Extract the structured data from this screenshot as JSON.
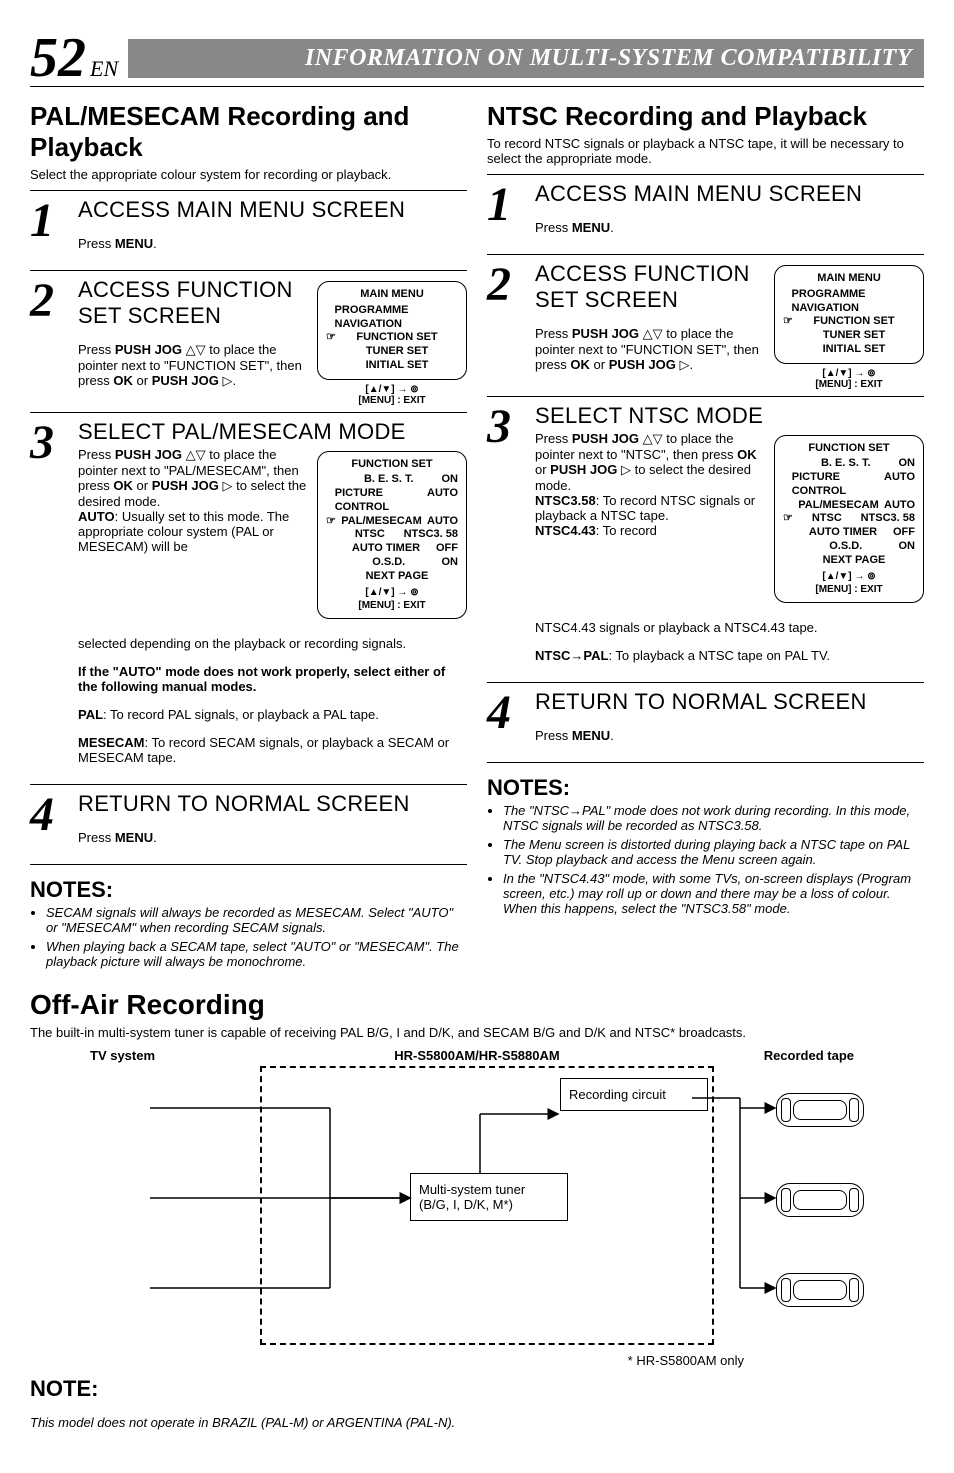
{
  "header": {
    "pagenum": "52",
    "lang": "EN",
    "banner": "INFORMATION ON MULTI-SYSTEM COMPATIBILITY"
  },
  "left": {
    "title": "PAL/MESECAM Recording and Playback",
    "lead": "Select the appropriate colour system for recording or playback.",
    "steps": {
      "s1": {
        "num": "1",
        "title": "ACCESS MAIN MENU SCREEN",
        "text_a": "Press ",
        "b1": "MENU",
        "text_b": "."
      },
      "s2": {
        "num": "2",
        "title": "ACCESS FUNCTION SET SCREEN",
        "run1a": "Press ",
        "run1b": "PUSH JOG",
        "run1c": " △▽ to place the pointer next to \"FUNCTION SET\", then press ",
        "run1d": "OK",
        "run1e": " or ",
        "run1f": "PUSH JOG",
        "run1g": " ▷."
      },
      "s3": {
        "num": "3",
        "title": "SELECT PAL/MESECAM MODE",
        "run_a": "Press ",
        "run_b": "PUSH JOG",
        "run_c": " △▽ to place the pointer next to \"PAL/MESECAM\", then press ",
        "run_d": "OK",
        "run_e": " or ",
        "run_f": "PUSH JOG",
        "run_g": " ▷ to select the desired mode.",
        "auto_l": "AUTO",
        "auto_t": ": Usually set to this mode. The appropriate colour system (PAL or MESECAM) will be",
        "tail": "selected depending on the playback or recording signals.",
        "warn": "If the \"AUTO\" mode does not work properly, select either of the following manual modes.",
        "pal_l": "PAL",
        "pal_t": ": To record PAL signals, or playback a PAL tape.",
        "mes_l": "MESECAM",
        "mes_t": ": To record SECAM signals, or playback a SECAM or MESECAM tape."
      },
      "s4": {
        "num": "4",
        "title": "RETURN TO NORMAL SCREEN",
        "text_a": "Press ",
        "b1": "MENU",
        "text_b": "."
      }
    },
    "osd_main": {
      "title": "MAIN MENU",
      "items": [
        "PROGRAMME NAVIGATION",
        "FUNCTION SET",
        "TUNER SET",
        "INITIAL SET"
      ],
      "pointer_idx": 1,
      "foot1": "[▲/▼] → ⊚",
      "foot2": "[MENU] : EXIT"
    },
    "osd_func": {
      "title": "FUNCTION SET",
      "rows": [
        {
          "l": "B. E. S. T.",
          "r": "ON"
        },
        {
          "l": "PICTURE CONTROL",
          "r": "AUTO"
        },
        {
          "l": "PAL/MESECAM",
          "r": "AUTO"
        },
        {
          "l": "NTSC",
          "r": "NTSC3. 58"
        },
        {
          "l": "AUTO TIMER",
          "r": "OFF"
        },
        {
          "l": "O.S.D.",
          "r": "ON"
        },
        {
          "l": "NEXT PAGE",
          "r": ""
        }
      ],
      "pointer_idx": 2,
      "foot1": "[▲/▼] → ⊚",
      "foot2": "[MENU] : EXIT"
    },
    "notes_h": "NOTES:",
    "notes": [
      "SECAM signals will always be recorded as MESECAM. Select \"AUTO\" or \"MESECAM\" when recording SECAM signals.",
      "When playing back a SECAM tape, select \"AUTO\" or \"MESECAM\". The playback picture will always be monochrome."
    ]
  },
  "right": {
    "title": "NTSC Recording and Playback",
    "lead": "To record NTSC signals or playback a NTSC tape, it will be necessary to select the appropriate mode.",
    "steps": {
      "s1": {
        "num": "1",
        "title": "ACCESS MAIN MENU SCREEN",
        "text_a": "Press ",
        "b1": "MENU",
        "text_b": "."
      },
      "s2": {
        "num": "2",
        "title": "ACCESS FUNCTION SET SCREEN",
        "run1a": "Press ",
        "run1b": "PUSH JOG",
        "run1c": " △▽ to place the pointer next to \"FUNCTION SET\", then press ",
        "run1d": "OK",
        "run1e": " or ",
        "run1f": "PUSH JOG",
        "run1g": " ▷."
      },
      "s3": {
        "num": "3",
        "title": "SELECT NTSC MODE",
        "run_a": "Press ",
        "run_b": "PUSH JOG",
        "run_c": " △▽ to place the pointer next to \"NTSC\", then press ",
        "run_d": "OK",
        "run_e": " or ",
        "run_f": "PUSH JOG",
        "run_g": " ▷ to select the desired mode.",
        "n358_l": "NTSC3.58",
        "n358_t": ": To record NTSC signals or playback a NTSC tape.",
        "n443_l": "NTSC4.43",
        "n443_t": ": To record",
        "n443_t2": "NTSC4.43 signals or playback a NTSC4.43 tape.",
        "np_l": "NTSC→PAL",
        "np_t": ": To playback a NTSC tape on PAL TV."
      },
      "s4": {
        "num": "4",
        "title": "RETURN TO NORMAL SCREEN",
        "text_a": "Press ",
        "b1": "MENU",
        "text_b": "."
      }
    },
    "osd_main": {
      "title": "MAIN MENU",
      "items": [
        "PROGRAMME NAVIGATION",
        "FUNCTION SET",
        "TUNER SET",
        "INITIAL SET"
      ],
      "pointer_idx": 1,
      "foot1": "[▲/▼] → ⊚",
      "foot2": "[MENU] : EXIT"
    },
    "osd_func": {
      "title": "FUNCTION SET",
      "rows": [
        {
          "l": "B. E. S. T.",
          "r": "ON"
        },
        {
          "l": "PICTURE CONTROL",
          "r": "AUTO"
        },
        {
          "l": "PAL/MESECAM",
          "r": "AUTO"
        },
        {
          "l": "NTSC",
          "r": "NTSC3. 58"
        },
        {
          "l": "AUTO TIMER",
          "r": "OFF"
        },
        {
          "l": "O.S.D.",
          "r": "ON"
        },
        {
          "l": "NEXT PAGE",
          "r": ""
        }
      ],
      "pointer_idx": 3,
      "foot1": "[▲/▼] → ⊚",
      "foot2": "[MENU] : EXIT"
    },
    "notes_h": "NOTES:",
    "notes": [
      "The \"NTSC→PAL\" mode does not work during recording. In this mode, NTSC signals will be recorded as NTSC3.58.",
      "The Menu screen is distorted during playing back a NTSC tape on PAL TV. Stop playback and access the Menu screen again.",
      "In the \"NTSC4.43\" mode, with some TVs, on-screen displays (Program screen, etc.) may roll up or down and there may be a loss of colour. When this happens, select the \"NTSC3.58\" mode."
    ]
  },
  "offair": {
    "title": "Off-Air Recording",
    "lead": "The built-in multi-system tuner is capable of receiving PAL B/G, I and D/K, and SECAM B/G and D/K and NTSC* broadcasts.",
    "lbl_tv": "TV system",
    "lbl_model": "HR-S5800AM/HR-S5880AM",
    "lbl_tape": "Recorded tape",
    "box_rec": "Recording circuit",
    "box_tuner": "Multi-system tuner (B/G, I, D/K, M*)",
    "foot": "* HR-S5800AM only",
    "note_h": "NOTE:",
    "note_t": "This model does not operate in BRAZIL (PAL-M) or ARGENTINA (PAL-N)."
  }
}
